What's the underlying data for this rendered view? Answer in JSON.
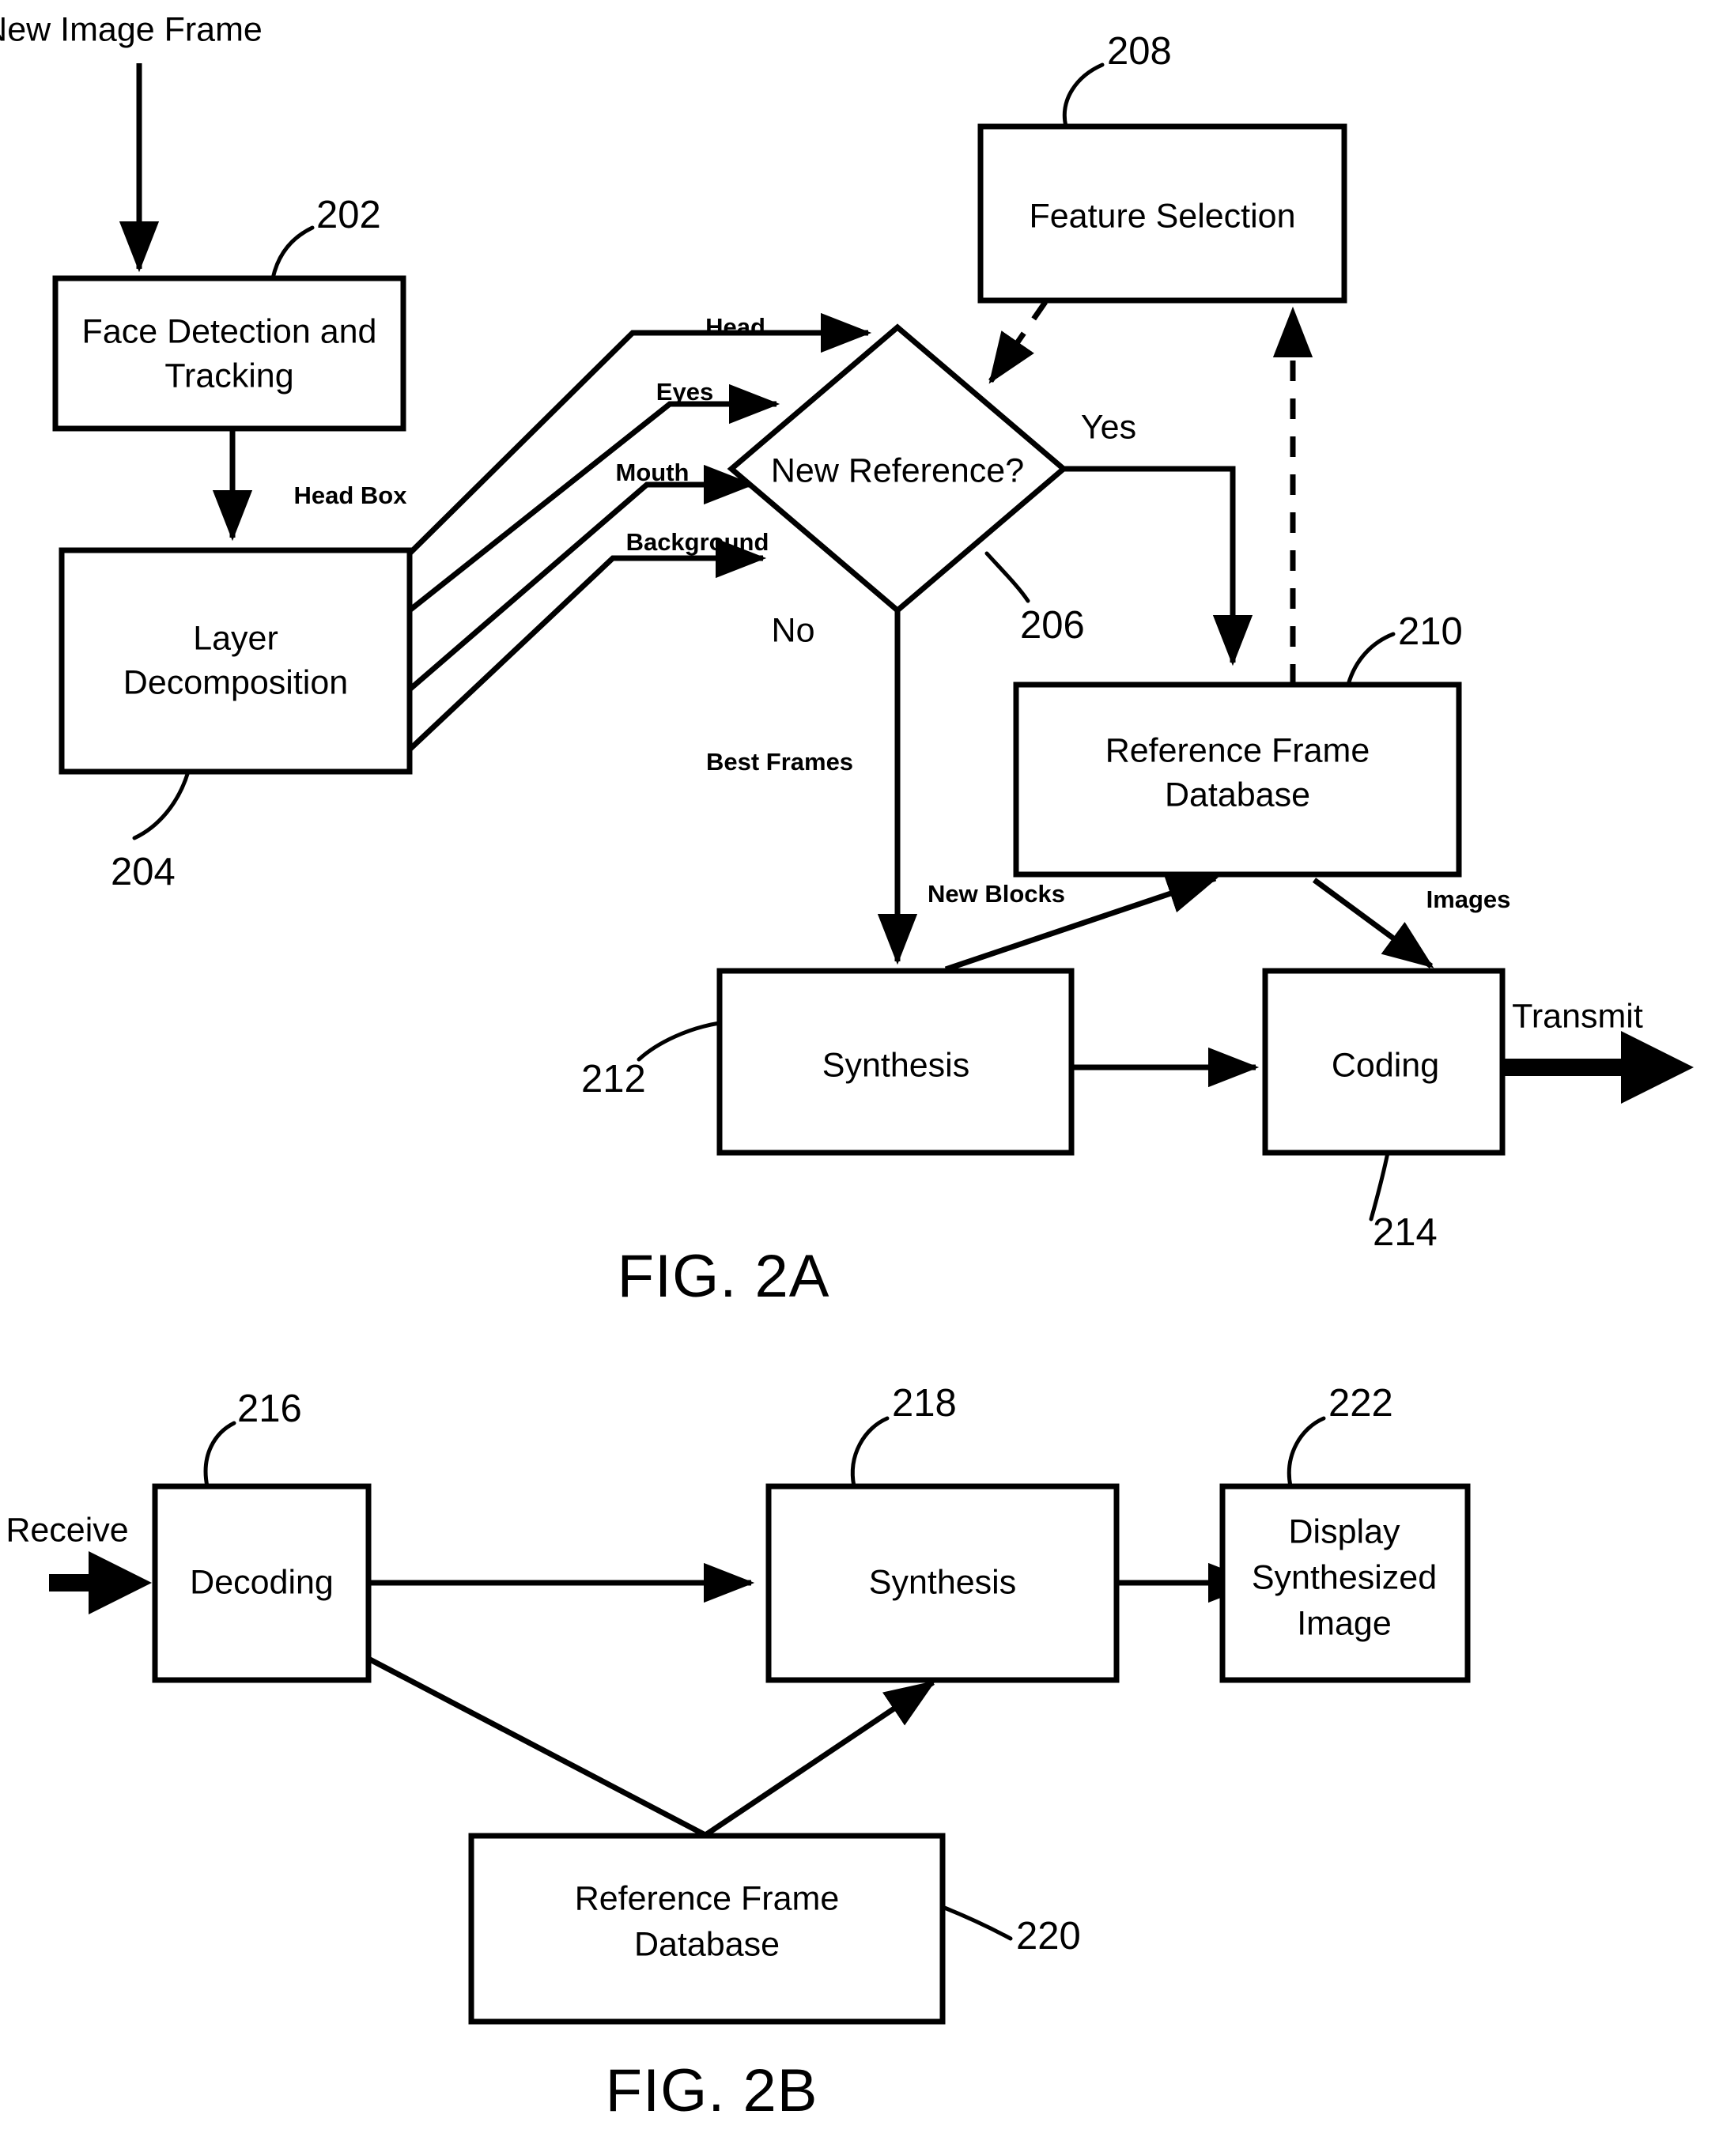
{
  "figure_2a": {
    "caption": "FIG. 2A",
    "input_label": "New Image Frame",
    "output_label": "Transmit",
    "blocks": [
      {
        "id": "202",
        "label_line1": "Face Detection and",
        "label_line2": "Tracking"
      },
      {
        "id": "204",
        "label_line1": "Layer",
        "label_line2": "Decomposition"
      },
      {
        "id": "208",
        "label_line1": "Feature Selection",
        "label_line2": ""
      },
      {
        "id": "210",
        "label_line1": "Reference Frame",
        "label_line2": "Database"
      },
      {
        "id": "212",
        "label_line1": "Synthesis",
        "label_line2": ""
      },
      {
        "id": "214",
        "label_line1": "Coding",
        "label_line2": ""
      }
    ],
    "decision": {
      "id": "206",
      "label": "New Reference?",
      "yes_label": "Yes",
      "no_label": "No"
    },
    "edge_labels": {
      "head_box": "Head Box",
      "head": "Head",
      "eyes": "Eyes",
      "mouth": "Mouth",
      "background": "Background",
      "best_frames": "Best Frames",
      "new_blocks": "New Blocks",
      "images": "Images"
    },
    "reference_numerals": [
      "202",
      "204",
      "206",
      "208",
      "210",
      "212",
      "214"
    ]
  },
  "figure_2b": {
    "caption": "FIG. 2B",
    "input_label": "Receive",
    "blocks": [
      {
        "id": "216",
        "label_line1": "Decoding",
        "label_line2": "",
        "label_line3": ""
      },
      {
        "id": "218",
        "label_line1": "Synthesis",
        "label_line2": "",
        "label_line3": ""
      },
      {
        "id": "222",
        "label_line1": "Display",
        "label_line2": "Synthesized",
        "label_line3": "Image"
      },
      {
        "id": "220",
        "label_line1": "Reference Frame",
        "label_line2": "Database",
        "label_line3": ""
      }
    ],
    "reference_numerals": [
      "216",
      "218",
      "220",
      "222"
    ]
  },
  "style": {
    "ink": "#000000",
    "paper": "#ffffff"
  }
}
